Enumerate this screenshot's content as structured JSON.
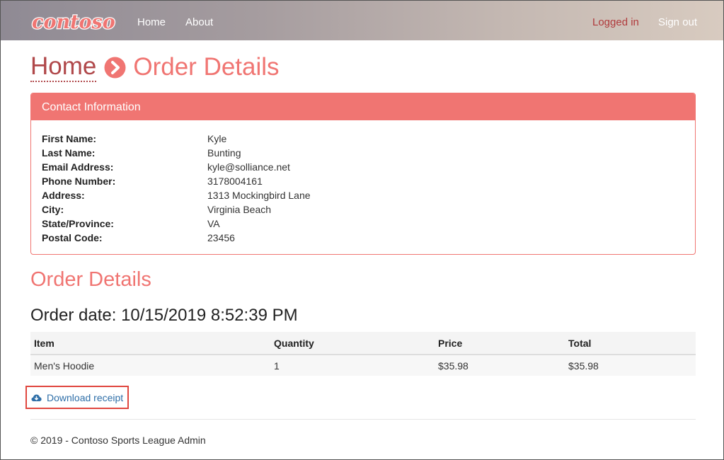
{
  "nav": {
    "logo_text": "contoso",
    "home": "Home",
    "about": "About",
    "logged_in": "Logged in",
    "sign_out": "Sign out"
  },
  "breadcrumb": {
    "home": "Home",
    "separator_icon": "chevron-circle-right-icon",
    "current": "Order Details"
  },
  "contact": {
    "heading": "Contact Information",
    "rows": [
      {
        "label": "First Name:",
        "value": "Kyle"
      },
      {
        "label": "Last Name:",
        "value": "Bunting"
      },
      {
        "label": "Email Address:",
        "value": "kyle@solliance.net"
      },
      {
        "label": "Phone Number:",
        "value": "3178004161"
      },
      {
        "label": "Address:",
        "value": "1313 Mockingbird Lane"
      },
      {
        "label": "City:",
        "value": "Virginia Beach"
      },
      {
        "label": "State/Province:",
        "value": "VA"
      },
      {
        "label": "Postal Code:",
        "value": "23456"
      }
    ]
  },
  "order": {
    "title": "Order Details",
    "date_text": "Order date: 10/15/2019 8:52:39 PM",
    "columns": [
      "Item",
      "Quantity",
      "Price",
      "Total"
    ],
    "rows": [
      [
        "Men's Hoodie",
        "1",
        "$35.98",
        "$35.98"
      ]
    ]
  },
  "download": {
    "icon": "cloud-download-icon",
    "label": "Download receipt"
  },
  "footer": {
    "text": "© 2019 - Contoso Sports League Admin"
  },
  "colors": {
    "accent": "#f07572",
    "accent_dark": "#b0484a",
    "link": "#2f6fa8",
    "highlight_box": "#e0473f"
  }
}
